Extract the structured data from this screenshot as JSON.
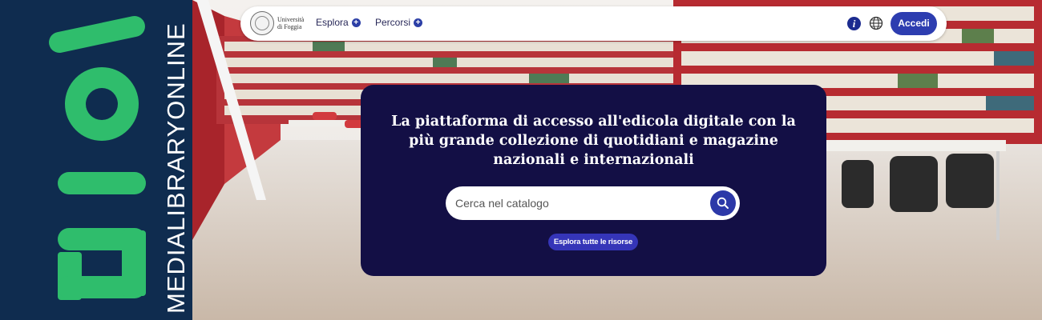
{
  "brand": {
    "logo_text": "mlol",
    "vertical_text": "MEDIALIBRARYONLINE",
    "logo_color": "#2fbd6c",
    "strip_color": "#0f2c4f"
  },
  "navbar": {
    "university_text": "Università di Foggia",
    "links": [
      {
        "label": "Esplora",
        "icon": "plus-circle-icon"
      },
      {
        "label": "Percorsi",
        "icon": "plus-circle-icon"
      }
    ],
    "info_icon": "i",
    "globe_icon": "globe-icon",
    "login_label": "Accedi"
  },
  "hero": {
    "title": "La piattaforma di accesso all'edicola digitale con la più grande collezione di quotidiani e magazine nazionali e internazionali",
    "search_placeholder": "Cerca nel catalogo",
    "search_icon": "search-icon",
    "explore_label": "Esplora tutte le risorse",
    "panel_color": "#130f45",
    "accent_color": "#2d3db0"
  }
}
